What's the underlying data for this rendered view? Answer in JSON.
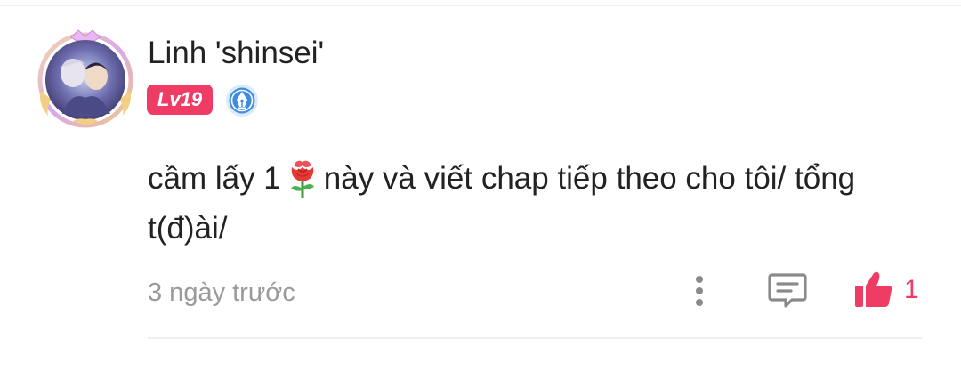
{
  "comment": {
    "user": {
      "name": "Linh 'shinsei'",
      "level": "Lv19",
      "avatar_icon": "avatar-anime-couple",
      "badge_icon": "pen-nib-badge-icon"
    },
    "text_before_emoji": "cầm lấy 1",
    "emoji_icon": "rose-icon",
    "text_after_emoji": "này và viết chap tiếp theo cho tôi/ tổng t(đ)ài/",
    "timestamp": "3 ngày trước",
    "actions": {
      "more_icon": "more-vertical-icon",
      "reply_icon": "comment-icon",
      "like_icon": "thumbs-up-icon",
      "like_count": "1"
    }
  },
  "colors": {
    "accent": "#ee3c64",
    "text": "#222222",
    "muted": "#9a9a9a",
    "icon_gray": "#8a8a8a",
    "badge_blue": "#3f8de0",
    "divider": "#efefef"
  }
}
